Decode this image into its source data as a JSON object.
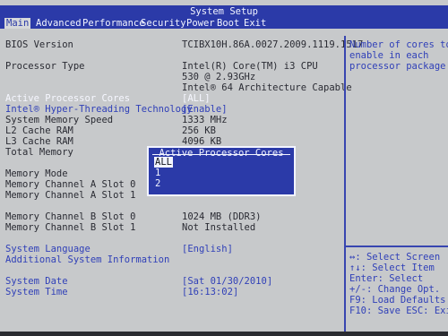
{
  "window": {
    "title": "System Setup"
  },
  "menu": [
    {
      "label": "Main",
      "selected": true
    },
    {
      "label": "Advanced"
    },
    {
      "label": "Performance"
    },
    {
      "label": "Security"
    },
    {
      "label": "Power"
    },
    {
      "label": "Boot"
    },
    {
      "label": "Exit"
    }
  ],
  "settings": {
    "bios_version": {
      "label": "BIOS Version",
      "value": "TCIBX10H.86A.0027.2009.1119.1517"
    },
    "processor_type": {
      "label": "Processor Type",
      "value_lines": [
        "Intel(R) Core(TM) i3 CPU",
        "530  @ 2.93GHz",
        "Intel® 64 Architecture Capable"
      ]
    },
    "active_cores": {
      "label": "Active Processor Cores",
      "value": "[ALL]"
    },
    "hyperthreading": {
      "label": "Intel® Hyper-Threading Technology",
      "value": "[Enable]"
    },
    "memory_speed": {
      "label": "System Memory Speed",
      "value": "1333 MHz"
    },
    "l2_cache": {
      "label": "L2 Cache RAM",
      "value": "256 KB"
    },
    "l3_cache": {
      "label": "L3 Cache RAM",
      "value": "4096 KB"
    },
    "total_memory": {
      "label": "Total Memory"
    },
    "memory_mode": {
      "label": "Memory Mode"
    },
    "chan_a_slot0": {
      "label": "Memory Channel A Slot 0"
    },
    "chan_a_slot1": {
      "label": "Memory Channel A Slot 1"
    },
    "chan_b_slot0": {
      "label": "Memory Channel B Slot 0",
      "value": "1024 MB (DDR3)"
    },
    "chan_b_slot1": {
      "label": "Memory Channel B Slot 1",
      "value": "Not Installed"
    },
    "language": {
      "label": "System Language",
      "value": "[English]"
    },
    "additional_info": {
      "label": "Additional System Information"
    },
    "date": {
      "label": "System Date",
      "value": "[Sat 01/30/2010]"
    },
    "time": {
      "label": "System Time",
      "value": "[16:13:02]"
    }
  },
  "help_text": [
    "Number of cores to",
    "enable in each",
    "processor package"
  ],
  "key_help": [
    "↔: Select Screen",
    "↑↓: Select Item",
    "Enter: Select",
    "+/-: Change Opt.",
    "F9: Load Defaults",
    "F10: Save  ESC: Exit"
  ],
  "popup": {
    "title": "Active Processor Cores",
    "options": [
      {
        "label": "ALL",
        "selected": true
      },
      {
        "label": "1"
      },
      {
        "label": "2"
      }
    ]
  },
  "colors": {
    "background": "#c7c9cb",
    "accent": "#2b3aa8",
    "text": "#2a2b33",
    "link": "#3040b8"
  }
}
